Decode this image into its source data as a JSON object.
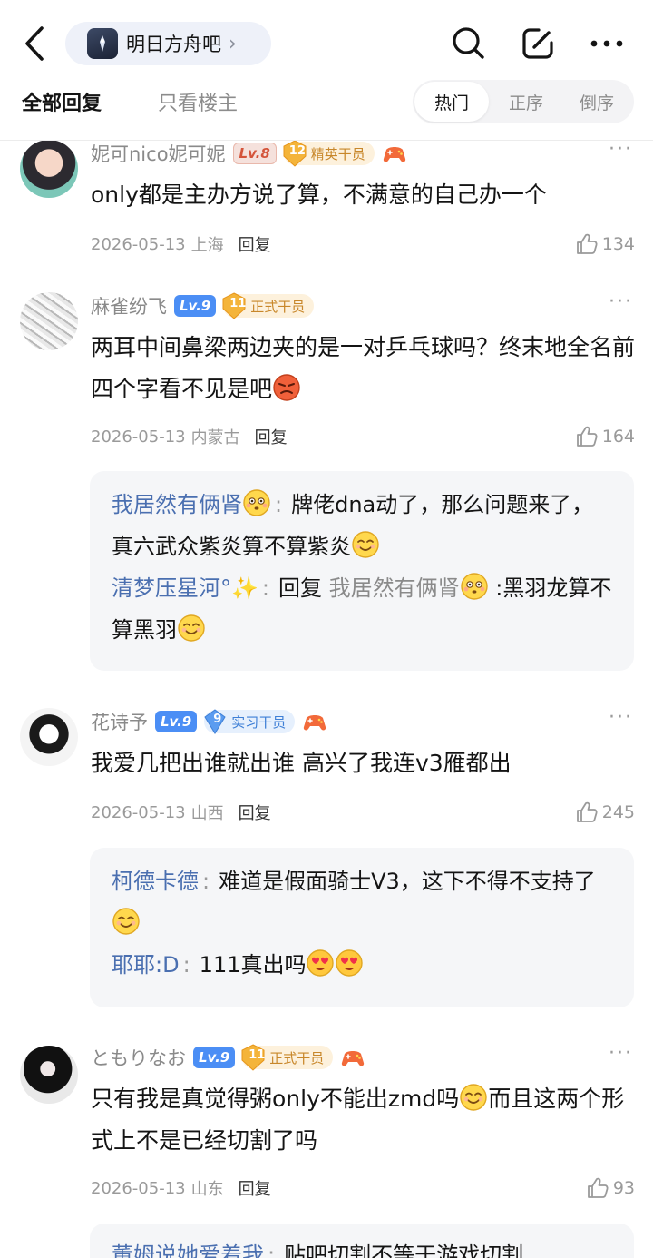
{
  "header": {
    "forum_name": "明日方舟吧",
    "tabs": {
      "all": "全部回复",
      "op_only": "只看楼主"
    },
    "sort": {
      "hot": "热门",
      "asc": "正序",
      "desc": "倒序"
    }
  },
  "comments": [
    {
      "username": "妮可nico妮可妮",
      "level": "Lv.8",
      "title_num": "12",
      "title": "精英干员",
      "text": "only都是主办方说了算，不满意的自己办一个",
      "date": "2026-05-13",
      "location": "上海",
      "reply": "回复",
      "likes": "134"
    },
    {
      "username": "麻雀纷飞",
      "level": "Lv.9",
      "title_num": "11",
      "title": "正式干员",
      "text": "两耳中间鼻梁两边夹的是一对乒乓球吗？终末地全名前四个字看不见是吧",
      "date": "2026-05-13",
      "location": "内蒙古",
      "reply": "回复",
      "likes": "164",
      "subs": [
        {
          "name": "我居然有俩肾",
          "text": "牌佬dna动了，那么问题来了，真六武众紫炎算不算紫炎"
        },
        {
          "name": "清梦压星河°✨",
          "reply_kw": "回复",
          "target": "我居然有俩肾",
          "text": ":黑羽龙算不算黑羽"
        }
      ]
    },
    {
      "username": "花诗予",
      "level": "Lv.9",
      "title_num": "9",
      "title": "实习干员",
      "text": "我爱几把出谁就出谁 高兴了我连v3雁都出",
      "date": "2026-05-13",
      "location": "山西",
      "reply": "回复",
      "likes": "245",
      "subs": [
        {
          "name": "柯德卡德",
          "text": "难道是假面骑士V3，这下不得不支持了"
        },
        {
          "name": "耶耶:D",
          "text": "111真出吗"
        }
      ]
    },
    {
      "username": "ともりなお",
      "level": "Lv.9",
      "title_num": "11",
      "title": "正式干员",
      "text_a": "只有我是真觉得粥only不能出zmd吗",
      "text_b": "而且这两个形式上不是已经切割了吗",
      "date": "2026-05-13",
      "location": "山东",
      "reply": "回复",
      "likes": "93",
      "subs": [
        {
          "name": "董姆说她爱着我",
          "text": "贴吧切割不等于游戏切割"
        }
      ]
    }
  ]
}
